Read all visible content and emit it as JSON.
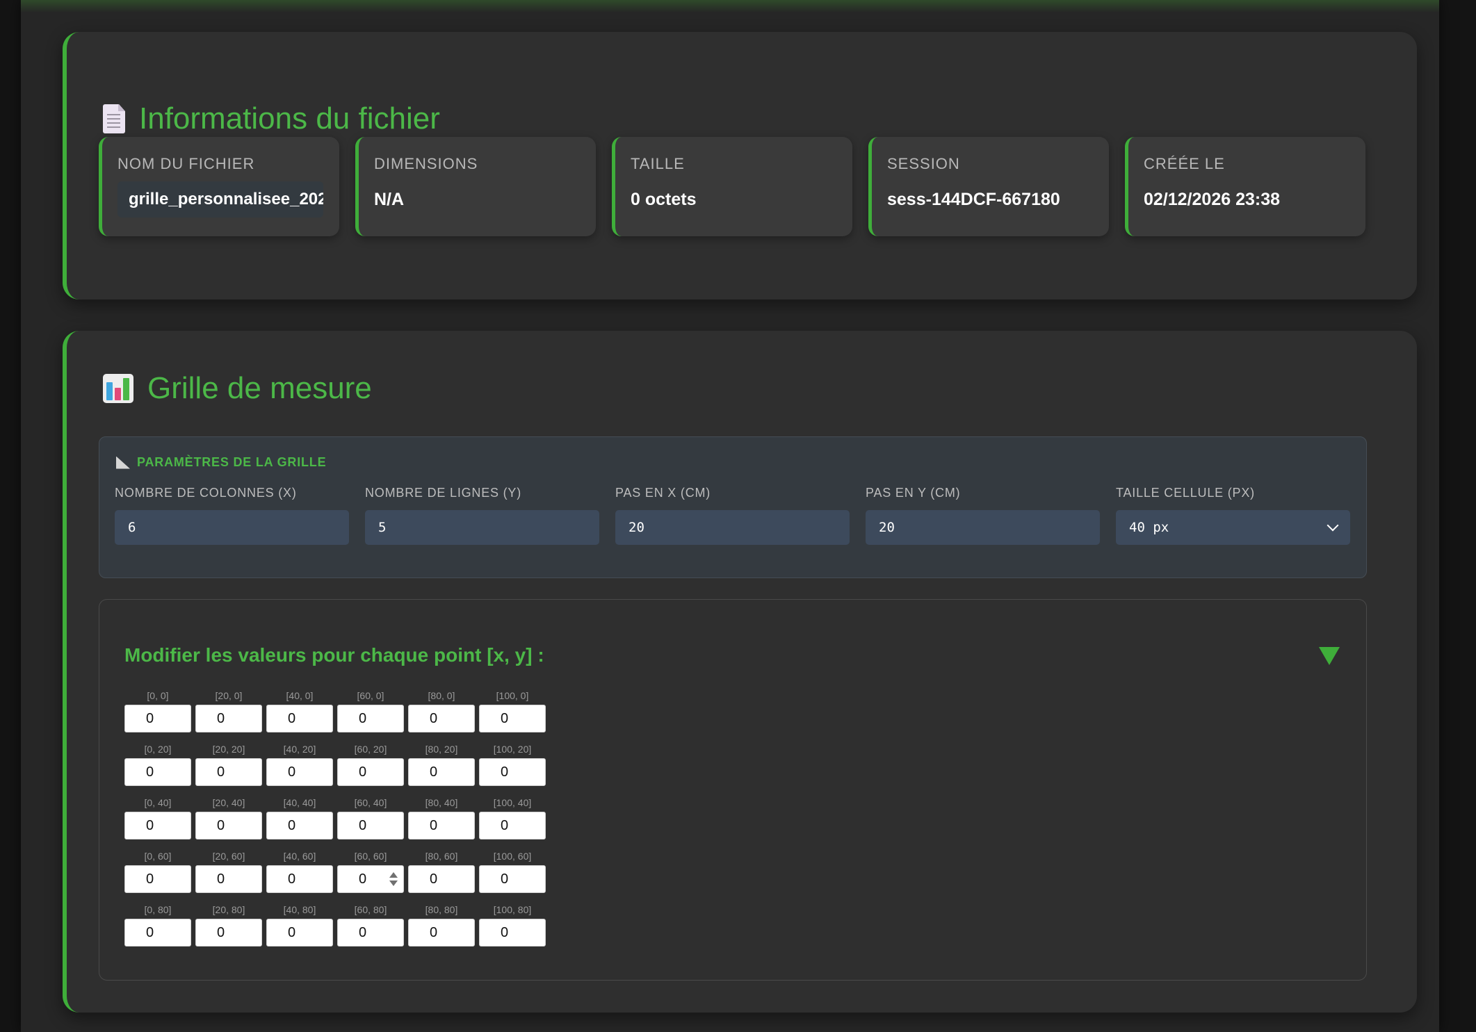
{
  "file_info": {
    "title": "Informations du fichier",
    "icon": "document-icon",
    "cards": [
      {
        "label": "NOM DU FICHIER",
        "value": "grille_personnalisee_202"
      },
      {
        "label": "DIMENSIONS",
        "value": "N/A"
      },
      {
        "label": "TAILLE",
        "value": "0 octets"
      },
      {
        "label": "SESSION",
        "value": "sess-144DCF-667180"
      },
      {
        "label": "CRÉÉE LE",
        "value": "02/12/2026 23:38"
      }
    ]
  },
  "grid": {
    "title": "Grille de mesure",
    "icon": "bar-chart-icon",
    "params": {
      "heading": "PARAMÈTRES DE LA GRILLE",
      "heading_icon": "ruler-icon",
      "fields": [
        {
          "label": "NOMBRE DE COLONNES (X)",
          "value": "6"
        },
        {
          "label": "NOMBRE DE LIGNES (Y)",
          "value": "5"
        },
        {
          "label": "PAS EN X (CM)",
          "value": "20"
        },
        {
          "label": "PAS EN Y (CM)",
          "value": "20"
        },
        {
          "label": "TAILLE CELLULE (PX)",
          "value": "40 px"
        }
      ]
    },
    "editor": {
      "title": "Modifier les valeurs pour chaque point [x, y] :",
      "rows": [
        {
          "labels": [
            "[0, 0]",
            "[20, 0]",
            "[40, 0]",
            "[60, 0]",
            "[80, 0]",
            "[100, 0]"
          ],
          "values": [
            "0",
            "0",
            "0",
            "0",
            "0",
            "0"
          ]
        },
        {
          "labels": [
            "[0, 20]",
            "[20, 20]",
            "[40, 20]",
            "[60, 20]",
            "[80, 20]",
            "[100, 20]"
          ],
          "values": [
            "0",
            "0",
            "0",
            "0",
            "0",
            "0"
          ]
        },
        {
          "labels": [
            "[0, 40]",
            "[20, 40]",
            "[40, 40]",
            "[60, 40]",
            "[80, 40]",
            "[100, 40]"
          ],
          "values": [
            "0",
            "0",
            "0",
            "0",
            "0",
            "0"
          ]
        },
        {
          "labels": [
            "[0, 60]",
            "[20, 60]",
            "[40, 60]",
            "[60, 60]",
            "[80, 60]",
            "[100, 60]"
          ],
          "values": [
            "0",
            "0",
            "0",
            "0",
            "0",
            "0"
          ]
        },
        {
          "labels": [
            "[0, 80]",
            "[20, 80]",
            "[40, 80]",
            "[60, 80]",
            "[80, 80]",
            "[100, 80]"
          ],
          "values": [
            "0",
            "0",
            "0",
            "0",
            "0",
            "0"
          ]
        }
      ]
    }
  },
  "colors": {
    "accent": "#3fae3a",
    "title_green": "#4cb848",
    "background": "#262626",
    "panel": "#2f2f2f"
  }
}
